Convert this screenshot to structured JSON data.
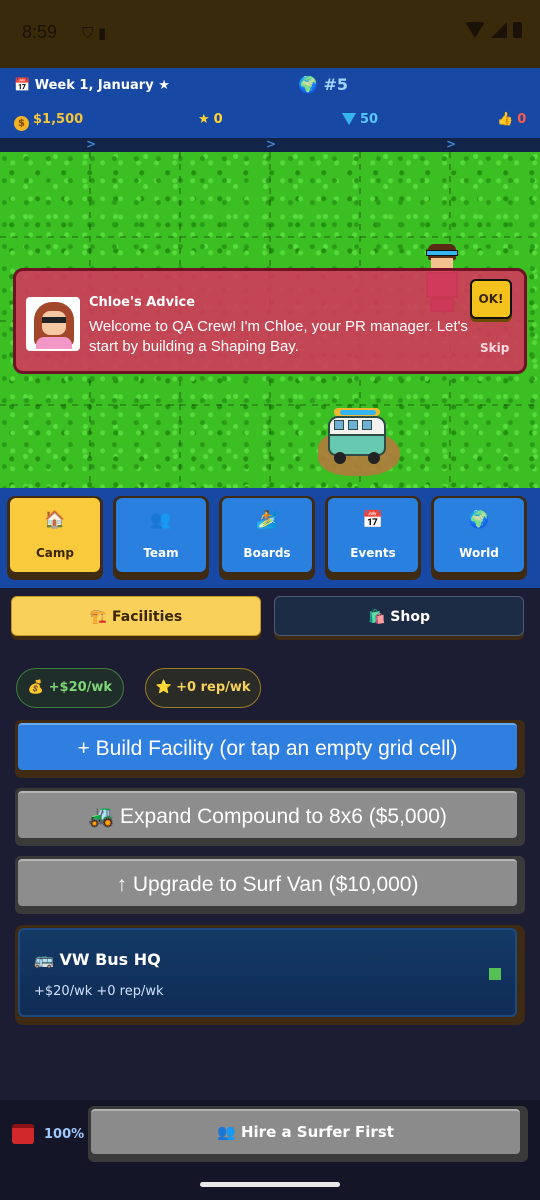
{
  "status_bar": {
    "time": "8:59",
    "left_icons": "⛉ ▮"
  },
  "header": {
    "week": "Week 1, January ★",
    "week_icon": "calendar-icon",
    "rank": "#5",
    "rank_icon": "globe-icon",
    "money": "$1,500",
    "stars": "0",
    "gems": "50",
    "likes": "0"
  },
  "advice": {
    "title": "Chloe's Advice",
    "message": "Welcome to QA Crew! I'm Chloe, your PR manager. Let's start by building a Shaping Bay.",
    "ok_label": "OK!",
    "skip_label": "Skip"
  },
  "tabs": [
    {
      "label": "Camp",
      "icon": "🏠",
      "icon_name": "home-icon",
      "active": true
    },
    {
      "label": "Team",
      "icon": "👥",
      "icon_name": "team-icon",
      "active": false
    },
    {
      "label": "Boards",
      "icon": "🏄",
      "icon_name": "surfer-icon",
      "active": false
    },
    {
      "label": "Events",
      "icon": "📅",
      "icon_name": "calendar-icon",
      "active": false
    },
    {
      "label": "World",
      "icon": "🌍",
      "icon_name": "globe-icon",
      "active": false
    }
  ],
  "subtabs": {
    "facilities": "🏗️ Facilities",
    "shop": "🛍️ Shop"
  },
  "pills": {
    "money": "💰 +$20/wk",
    "rep": "⭐ +0 rep/wk"
  },
  "actions": {
    "build": "+ Build Facility (or tap an empty grid cell)",
    "expand": "🚜 Expand Compound to 8x6 ($5,000)",
    "upgrade": "↑ Upgrade to Surf Van ($10,000)"
  },
  "facility": {
    "name": "🚌 VW Bus HQ",
    "stats": "+$20/wk  +0 rep/wk"
  },
  "bottom": {
    "percent": "100%",
    "hire_label": "👥 Hire a Surfer First"
  },
  "colors": {
    "header_blue": "#1748a4",
    "accent_yellow": "#f8ca3c",
    "tab_blue": "#2a80de",
    "advice_red": "#ce3c58"
  }
}
